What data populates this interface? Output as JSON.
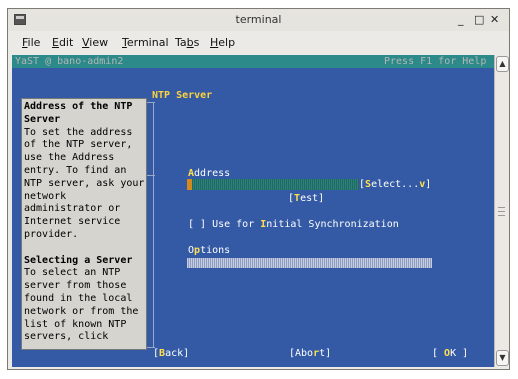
{
  "window": {
    "title": "terminal",
    "controls": {
      "minimize": "_",
      "maximize": "□",
      "close": "✕"
    }
  },
  "menubar": {
    "items": [
      {
        "label": "File",
        "mnemonic": "F",
        "rest": "ile"
      },
      {
        "label": "Edit",
        "mnemonic": "E",
        "rest": "dit"
      },
      {
        "label": "View",
        "mnemonic": "V",
        "rest": "iew"
      },
      {
        "label": "Terminal",
        "mnemonic": "T",
        "rest": "erminal"
      },
      {
        "label": "Tabs",
        "pre": "Ta",
        "mnemonic": "b",
        "rest": "s"
      },
      {
        "label": "Help",
        "mnemonic": "H",
        "rest": "elp"
      }
    ]
  },
  "terminal": {
    "header_left": "YaST @ bano-admin2",
    "header_right": "Press F1 for Help",
    "panel_title": "NTP Server",
    "help_lines": [
      {
        "text": "Address of the NTP",
        "bold": true
      },
      {
        "text": "Server",
        "bold": true
      },
      {
        "text": "To set the address",
        "bold": false
      },
      {
        "text": "of the NTP server,",
        "bold": false
      },
      {
        "text": "use the Address",
        "bold": false
      },
      {
        "text": "entry. To find an",
        "bold": false
      },
      {
        "text": "NTP server, ask your",
        "bold": false
      },
      {
        "text": "network",
        "bold": false
      },
      {
        "text": "administrator or",
        "bold": false
      },
      {
        "text": "Internet service",
        "bold": false
      },
      {
        "text": "provider.",
        "bold": false
      },
      {
        "text": "",
        "bold": false
      },
      {
        "text": "Selecting a Server",
        "bold": true
      },
      {
        "text": "To select an NTP",
        "bold": false
      },
      {
        "text": "server from those",
        "bold": false
      },
      {
        "text": "found in the local",
        "bold": false
      },
      {
        "text": "network or from the",
        "bold": false
      },
      {
        "text": "list of known NTP",
        "bold": false
      },
      {
        "text": "servers, click",
        "bold": false
      }
    ],
    "address_label": {
      "hot": "A",
      "rest": "ddress"
    },
    "select_button": {
      "pre": "[",
      "hot": "S",
      "rest": "elect...",
      "arrow": "v",
      "post": "]"
    },
    "test_button": {
      "pre": "[",
      "hot": "T",
      "rest": "est",
      "post": "]"
    },
    "init_sync": {
      "checkbox": "[ ]",
      "pre": " Use for ",
      "hot": "I",
      "rest": "nitial Synchronization"
    },
    "options_label": {
      "pre": "O",
      "hot": "p",
      "rest": "tions"
    },
    "back_button": {
      "pre": "[",
      "hot": "B",
      "rest": "ack",
      "post": "]"
    },
    "abort_button": {
      "pre": "[Abo",
      "hot": "r",
      "rest": "t",
      "post": "]"
    },
    "ok_button": {
      "pre": "[ ",
      "hot": "O",
      "rest": "K",
      "post": " ]"
    }
  },
  "scrollbar": {
    "up": "▲",
    "down": "▼"
  }
}
